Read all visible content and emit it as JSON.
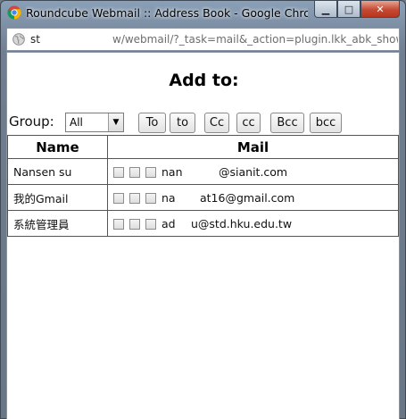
{
  "window": {
    "title": "Roundcube Webmail :: Address Book - Google Chrome",
    "controls": [
      "minimize-icon",
      "maximize-icon",
      "close-icon"
    ]
  },
  "address_bar": {
    "host": "st",
    "path": "w/webmail/?_task=mail&_action=plugin.lkk_abk_show&t=_"
  },
  "page": {
    "heading": "Add to:",
    "group_label": "Group:",
    "group_select": {
      "selected": "All"
    },
    "buttons": [
      "To",
      "to",
      "Cc",
      "cc",
      "Bcc",
      "bcc"
    ]
  },
  "table": {
    "headers": [
      "Name",
      "Mail"
    ],
    "rows": [
      {
        "name": "Nansen su",
        "mail_start": "nan",
        "mail_end": "@sianit.com"
      },
      {
        "name": "我的Gmail",
        "mail_start": "na",
        "mail_end": "at16@gmail.com"
      },
      {
        "name": "系統管理員",
        "mail_start": "ad",
        "mail_end": "u@std.hku.edu.tw"
      }
    ]
  }
}
